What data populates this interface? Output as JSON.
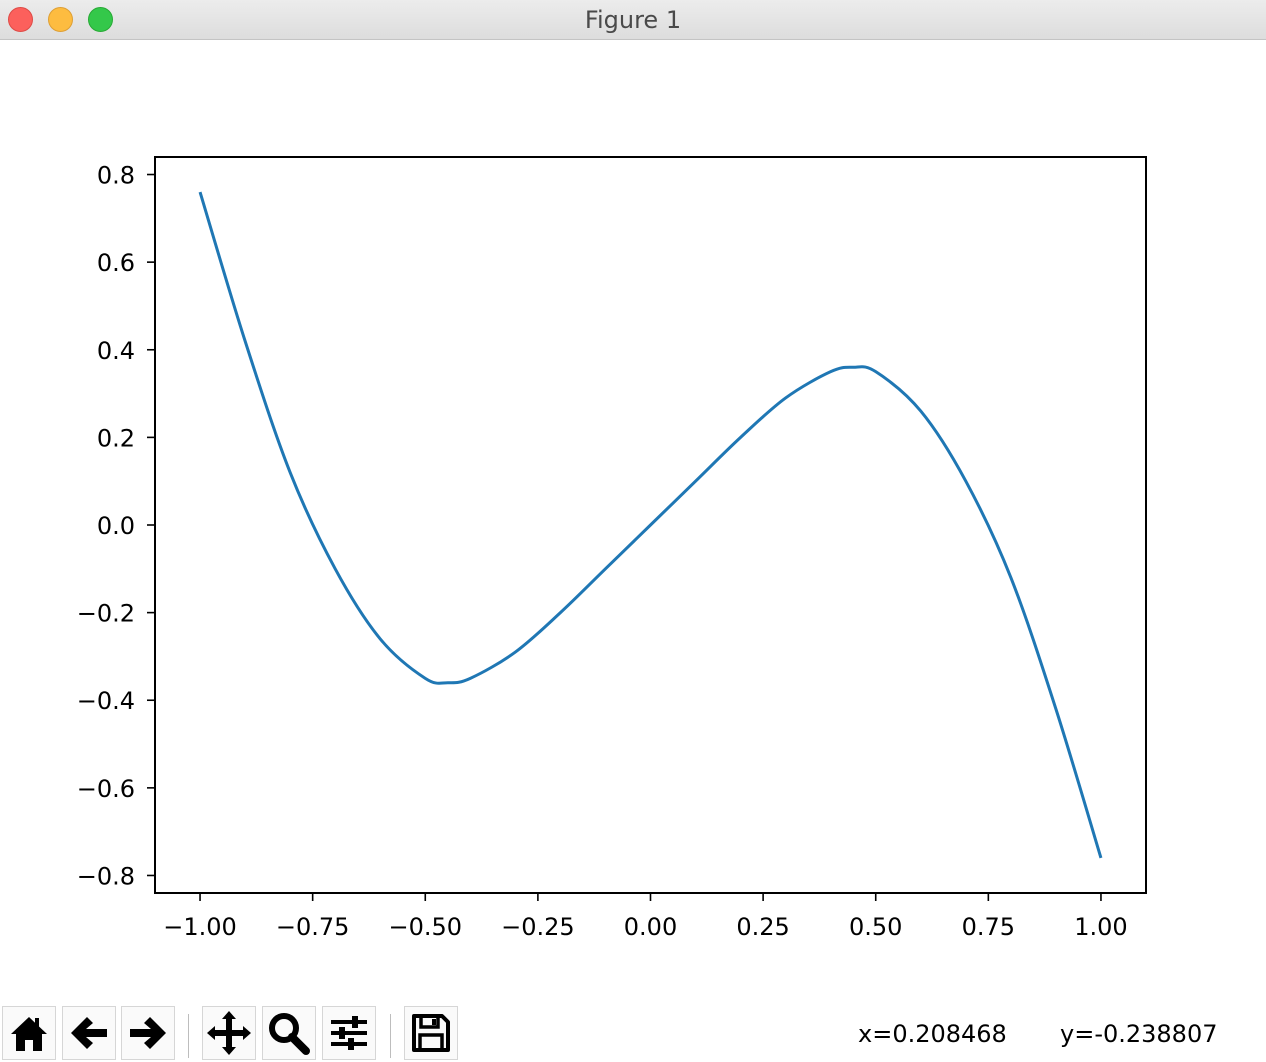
{
  "window": {
    "title": "Figure 1"
  },
  "toolbar": {
    "buttons": [
      {
        "icon": "home-icon",
        "label": "Home"
      },
      {
        "icon": "back-arrow-icon",
        "label": "Back"
      },
      {
        "icon": "forward-arrow-icon",
        "label": "Forward"
      },
      {
        "icon": "pan-icon",
        "label": "Pan"
      },
      {
        "icon": "zoom-icon",
        "label": "Zoom"
      },
      {
        "icon": "subplots-icon",
        "label": "Configure subplots"
      },
      {
        "icon": "save-icon",
        "label": "Save"
      }
    ]
  },
  "status": {
    "x_readout": "x=0.208468",
    "y_readout": "y=-0.238807"
  },
  "chart_data": {
    "type": "line",
    "title": "",
    "xlabel": "",
    "ylabel": "",
    "xlim": [
      -1.1,
      1.1
    ],
    "ylim": [
      -0.84,
      0.84
    ],
    "xticks": [
      -1.0,
      -0.75,
      -0.5,
      -0.25,
      0.0,
      0.25,
      0.5,
      0.75,
      1.0
    ],
    "xtick_labels": [
      "−1.00",
      "−0.75",
      "−0.50",
      "−0.25",
      "0.00",
      "0.25",
      "0.50",
      "0.75",
      "1.00"
    ],
    "yticks": [
      0.8,
      0.6,
      0.4,
      0.2,
      0.0,
      -0.2,
      -0.4,
      -0.6,
      -0.8
    ],
    "ytick_labels": [
      "0.8",
      "0.6",
      "0.4",
      "0.2",
      "0.0",
      "−0.2",
      "−0.4",
      "−0.6",
      "−0.8"
    ],
    "grid": false,
    "line_color": "#1f77b4",
    "series": [
      {
        "x": [
          -1.0,
          -0.9,
          -0.8,
          -0.7,
          -0.6,
          -0.5,
          -0.45,
          -0.4,
          -0.3,
          -0.2,
          -0.1,
          0.0,
          0.1,
          0.2,
          0.3,
          0.4,
          0.45,
          0.5,
          0.6,
          0.7,
          0.8,
          0.9,
          1.0
        ],
        "y": [
          0.76,
          0.42,
          0.12,
          -0.1,
          -0.26,
          -0.35,
          -0.36,
          -0.35,
          -0.29,
          -0.2,
          -0.1,
          0.0,
          0.1,
          0.2,
          0.29,
          0.35,
          0.36,
          0.35,
          0.26,
          0.1,
          -0.12,
          -0.42,
          -0.76
        ]
      }
    ]
  }
}
